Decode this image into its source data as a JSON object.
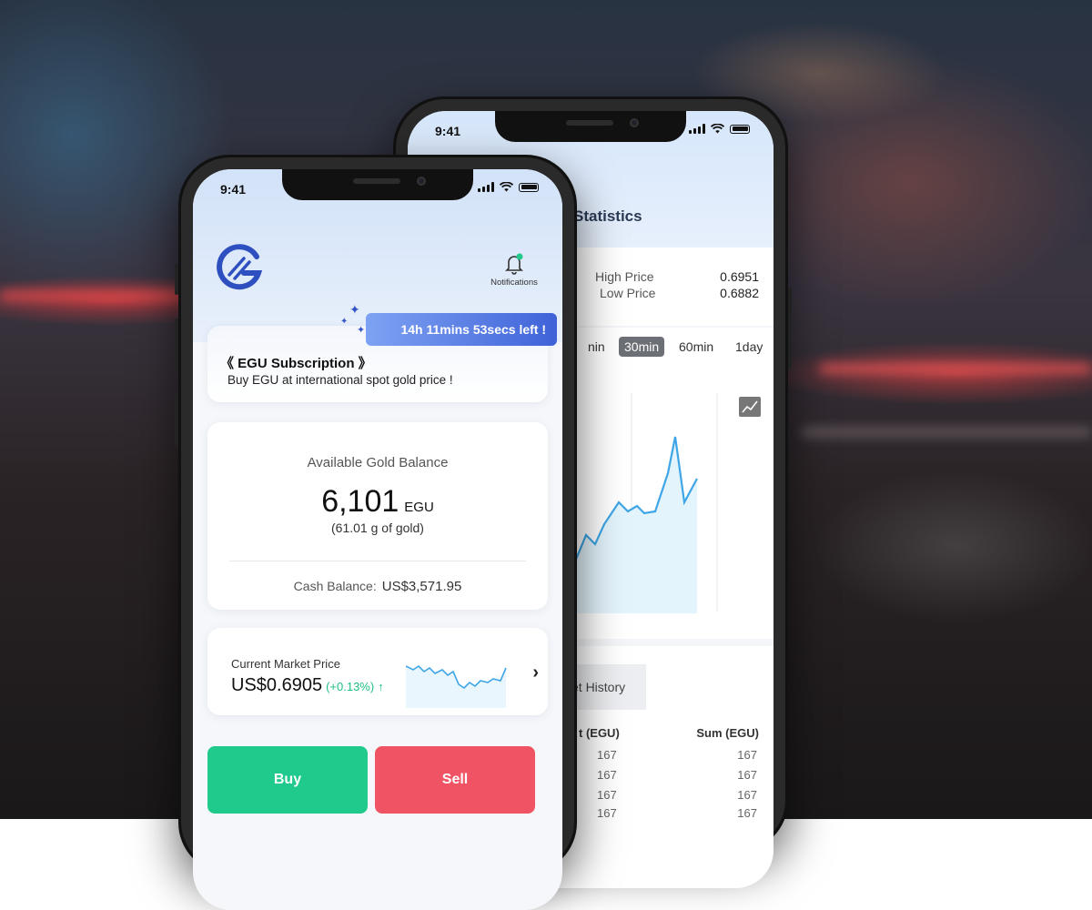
{
  "background": {
    "description_colors": {
      "accent_red": "#ff3c3c",
      "accent_blue": "#3c7aa0"
    }
  },
  "back_phone": {
    "status_time": "9:41",
    "title": "Statistics",
    "high_label": "High Price",
    "high_value": "0.6951",
    "low_label": "Low Price",
    "low_value": "0.6882",
    "timeframes": [
      {
        "label": "nin",
        "active": false
      },
      {
        "label": "30min",
        "active": true
      },
      {
        "label": "60min",
        "active": false
      },
      {
        "label": "1day",
        "active": false
      }
    ],
    "history_tab": "et History",
    "col_amount": "t (EGU)",
    "col_sum": "Sum (EGU)",
    "rows": [
      {
        "amount": "167",
        "sum": "167"
      },
      {
        "amount": "167",
        "sum": "167"
      },
      {
        "amount": "167",
        "sum": "167"
      },
      {
        "amount": "167",
        "sum": "167"
      }
    ],
    "line_color": "#3ea6e6"
  },
  "front_phone": {
    "status_time": "9:41",
    "notifications_label": "Notifications",
    "timer_text": "14h 11mins 53secs left !",
    "subscription_title": "《 EGU Subscription 》",
    "subscription_desc": "Buy EGU at international spot gold price !",
    "balance_label": "Available Gold Balance",
    "balance_amount": "6,101",
    "balance_unit": "EGU",
    "balance_grams": "(61.01 g of gold)",
    "cash_label": "Cash Balance:",
    "cash_amount": "US$3,571.95",
    "market_label": "Current Market Price",
    "market_price": "US$0.6905",
    "market_change": "(+0.13%)",
    "buy_label": "Buy",
    "sell_label": "Sell",
    "colors": {
      "buy": "#20c98c",
      "sell": "#f05363",
      "brand": "#2d4fbf",
      "positive": "#1fbf83"
    }
  }
}
